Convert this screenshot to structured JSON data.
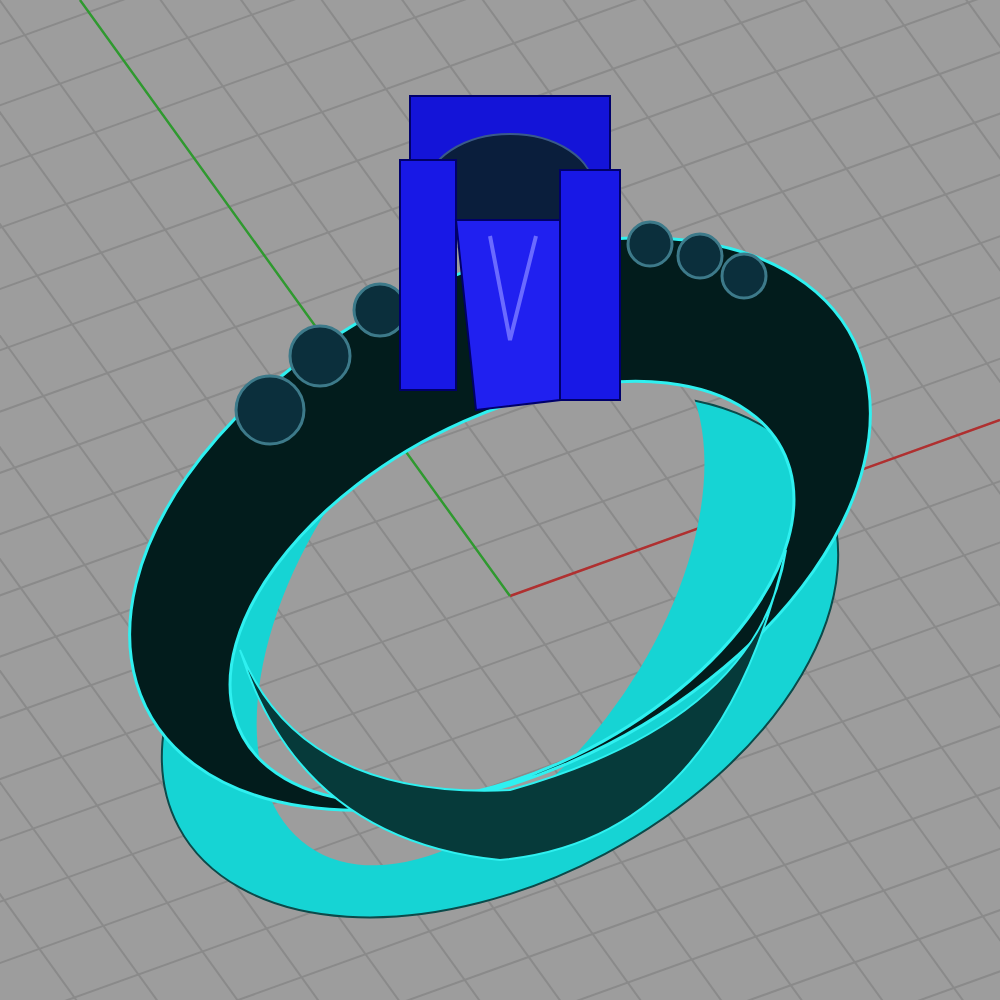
{
  "viewport": {
    "grid": true,
    "axes": true
  },
  "model": {
    "kind": "ring"
  }
}
